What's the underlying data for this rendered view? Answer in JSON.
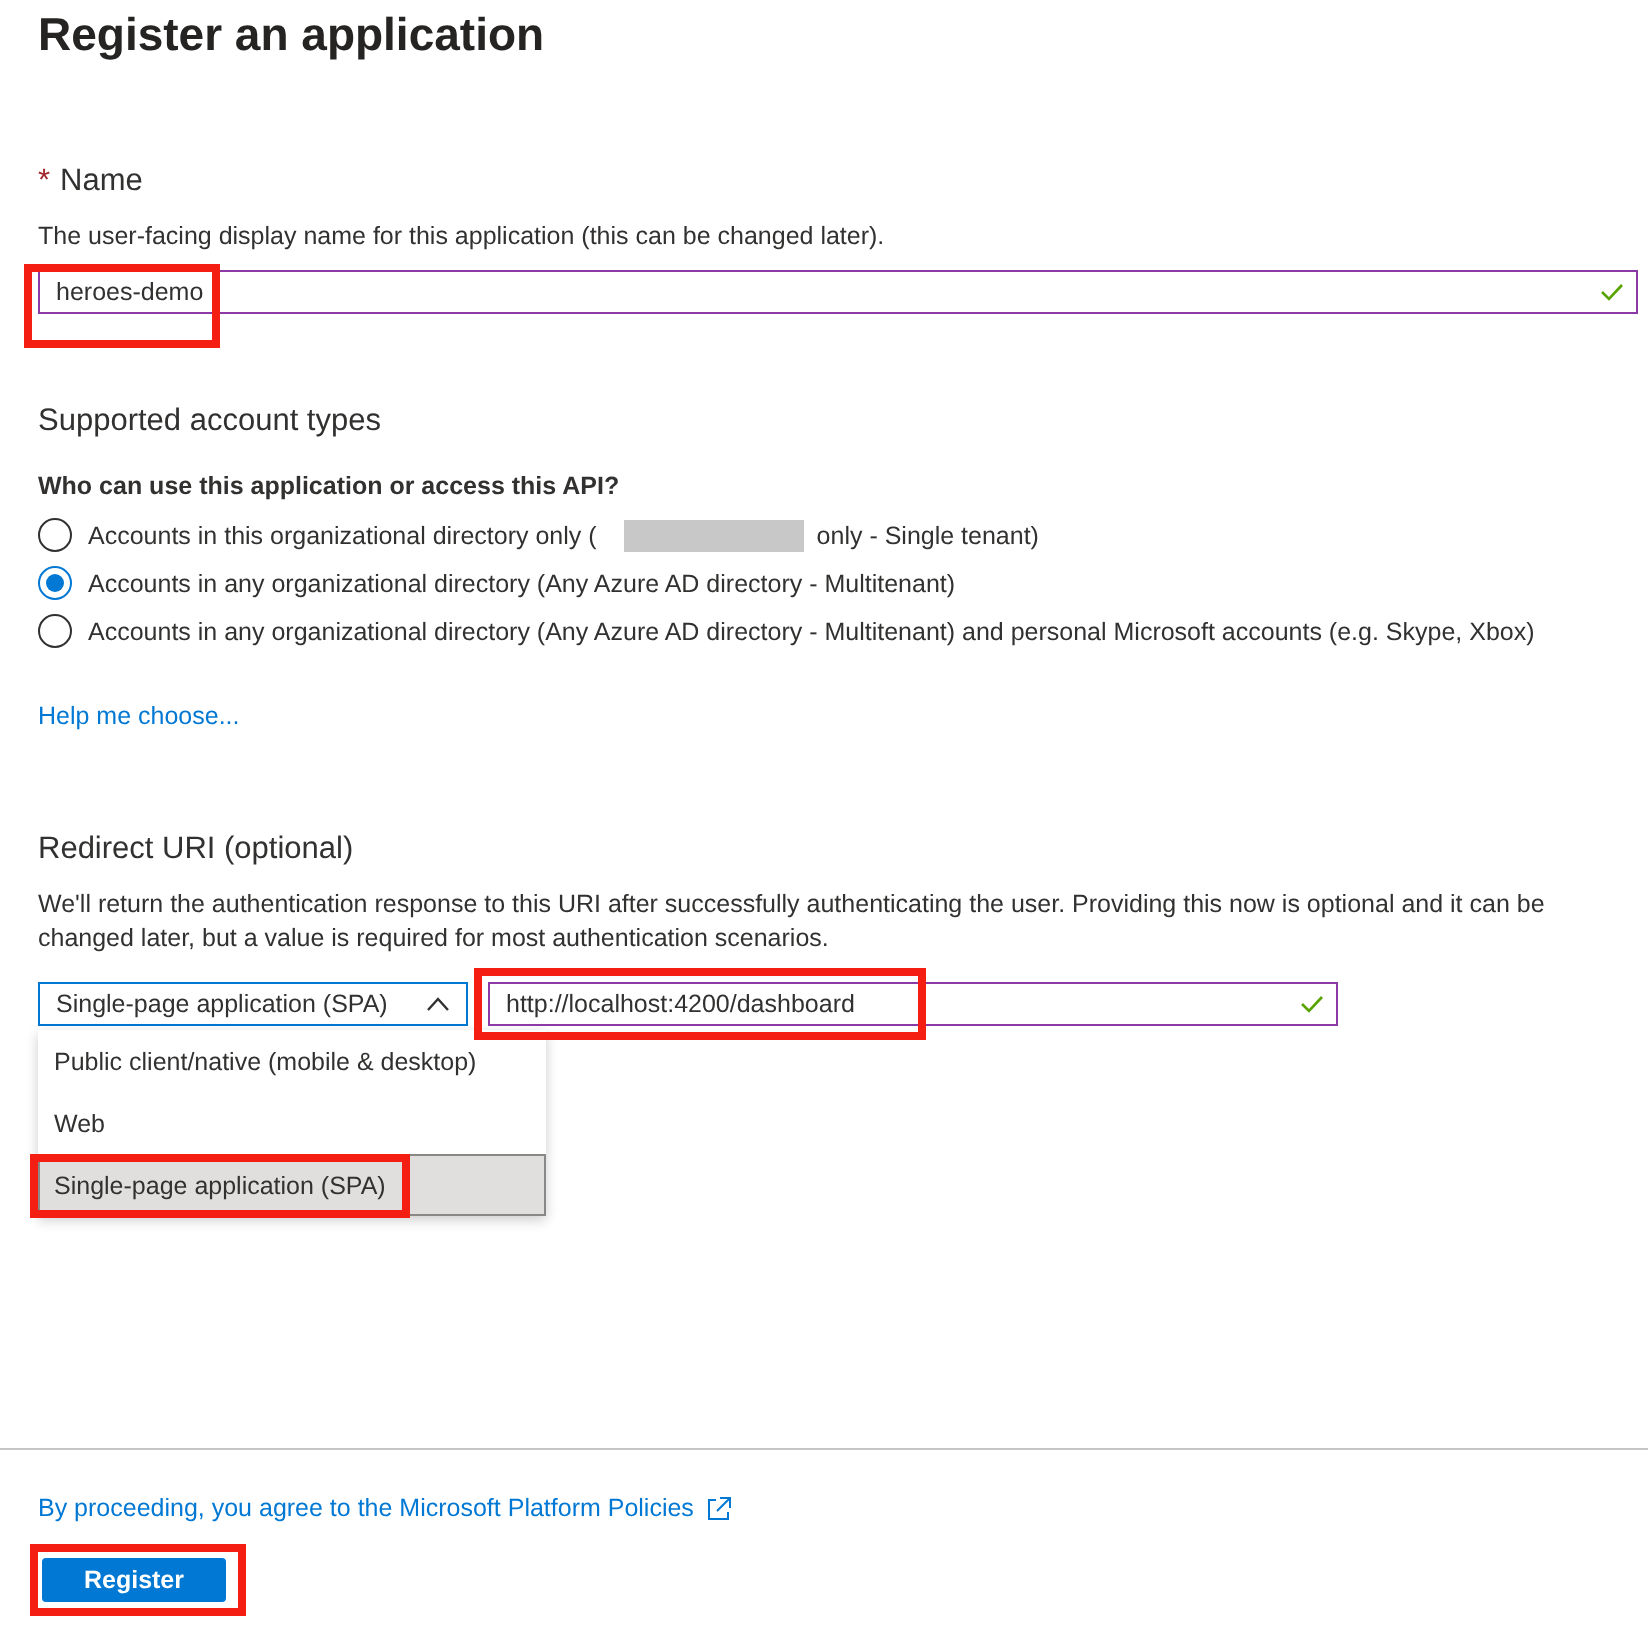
{
  "title": "Register an application",
  "name_section": {
    "required_mark": "*",
    "label": "Name",
    "description": "The user-facing display name for this application (this can be changed later).",
    "field": {
      "value": "heroes-demo",
      "valid": true,
      "highlighted": true
    }
  },
  "account_types": {
    "heading": "Supported account types",
    "question": "Who can use this application or access this API?",
    "options": [
      {
        "label": "Accounts in this organizational directory only (",
        "label_after": " only - Single tenant)",
        "selected": false
      },
      {
        "label": "Accounts in any organizational directory (Any Azure AD directory - Multitenant)",
        "selected": true
      },
      {
        "label": "Accounts in any organizational directory (Any Azure AD directory - Multitenant) and personal Microsoft accounts (e.g. Skype, Xbox)",
        "selected": false
      }
    ],
    "help_link": "Help me choose..."
  },
  "redirect": {
    "heading": "Redirect URI (optional)",
    "description": "We'll return the authentication response to this URI after successfully authenticating the user. Providing this now is optional and it can be changed later, but a value is required for most authentication scenarios.",
    "platform": {
      "value": "Single-page application (SPA)",
      "expanded": true,
      "options": [
        {
          "label": "Public client/native (mobile & desktop)",
          "selected": false,
          "highlighted": false
        },
        {
          "label": "Web",
          "selected": false,
          "highlighted": false
        },
        {
          "label": "Single-page application (SPA)",
          "selected": true,
          "highlighted": true
        }
      ]
    },
    "uri_field": {
      "value": "http://localhost:4200/dashboard",
      "valid": true,
      "highlighted": true
    }
  },
  "footer": {
    "policy_link": "By proceeding, you agree to the Microsoft Platform Policies",
    "register_button": {
      "label": "Register",
      "highlighted": true
    }
  }
}
